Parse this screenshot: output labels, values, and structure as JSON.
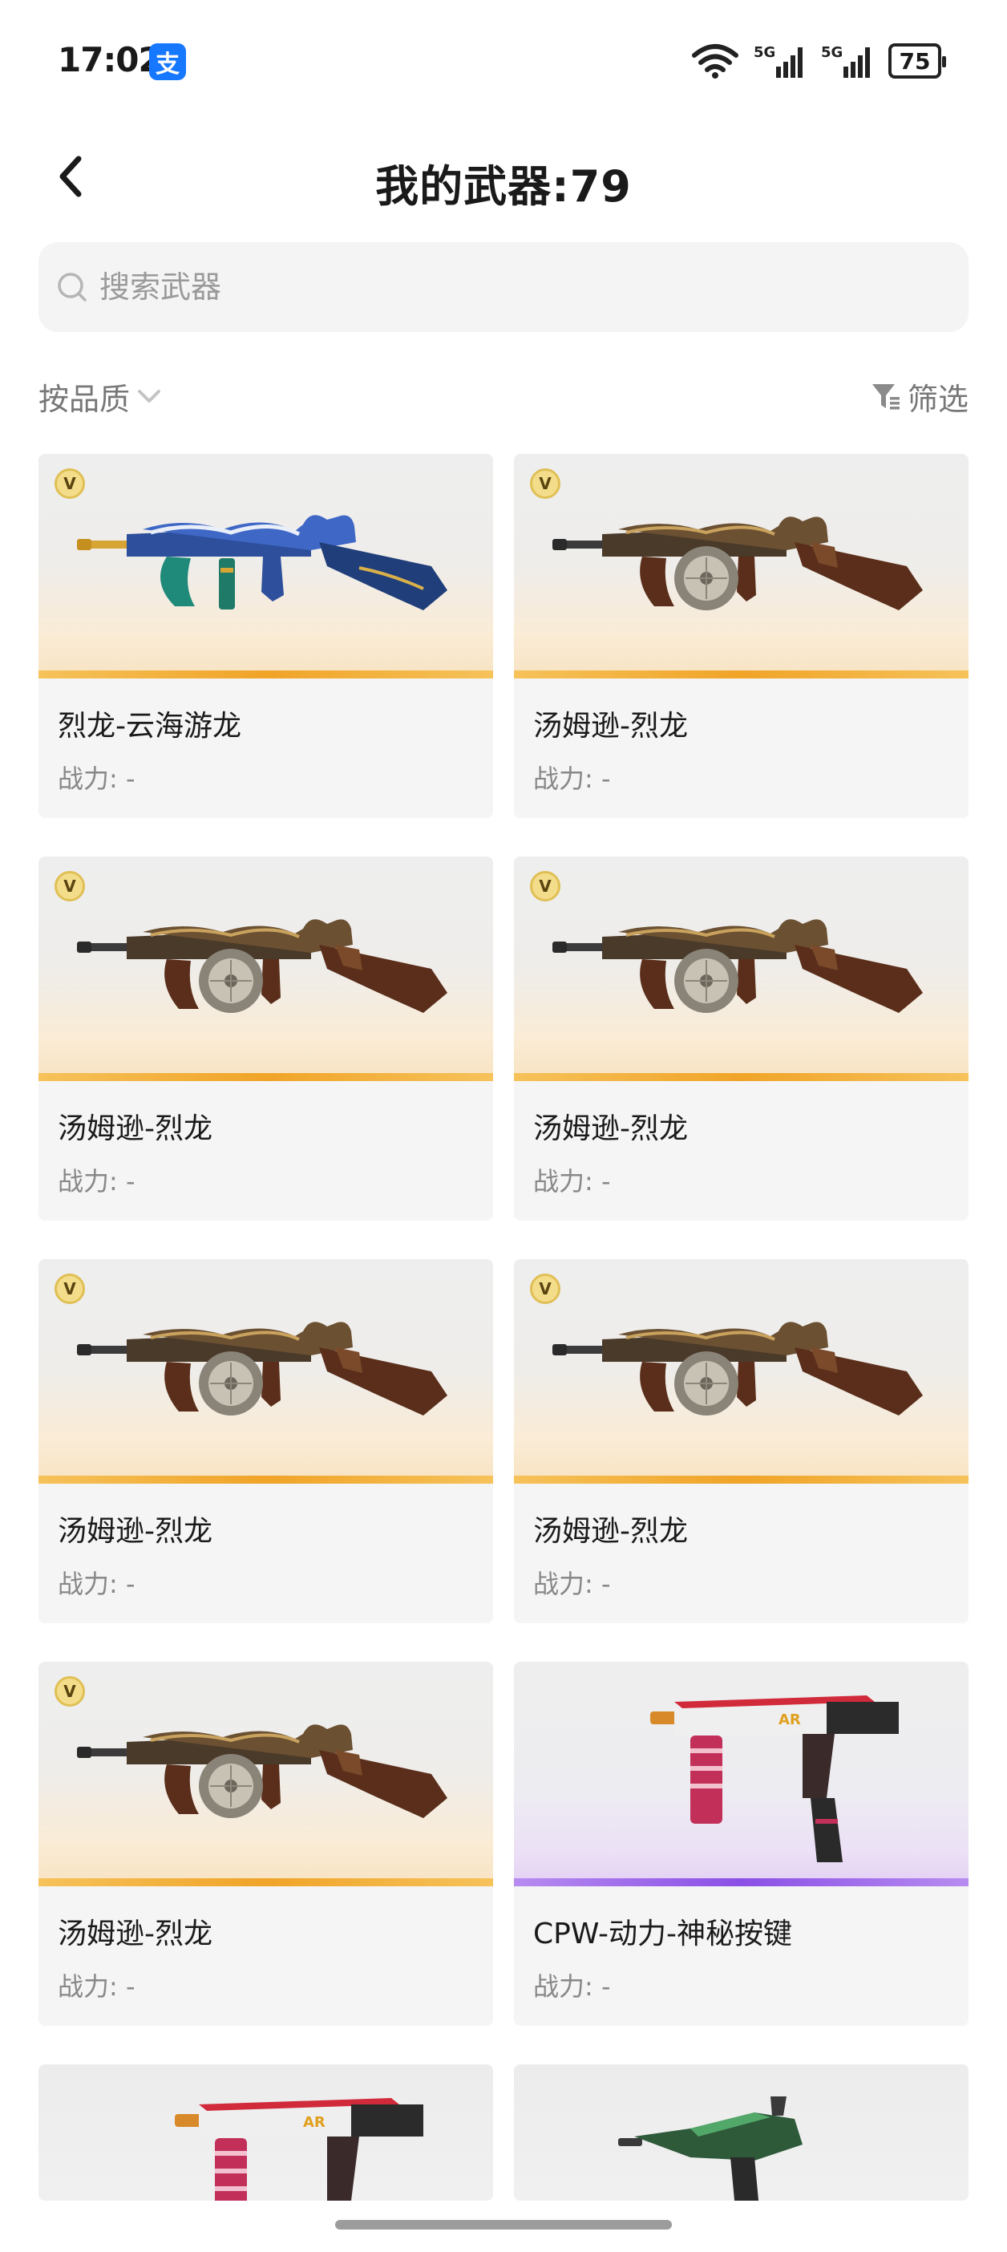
{
  "status_bar": {
    "time": "17:02",
    "app_badge": "支",
    "signal_1": "5G",
    "signal_2": "5G",
    "battery": "75"
  },
  "header": {
    "title": "我的武器:79"
  },
  "search": {
    "placeholder": "搜索武器"
  },
  "filters": {
    "sort_label": "按品质",
    "filter_label": "筛选"
  },
  "weapons": [
    {
      "name": "烈龙-云海游龙",
      "power": "战力: -",
      "rarity": "gold",
      "badge": "V",
      "art": "blue-dragon-smg"
    },
    {
      "name": "汤姆逊-烈龙",
      "power": "战力: -",
      "rarity": "gold",
      "badge": "V",
      "art": "dragon-smg"
    },
    {
      "name": "汤姆逊-烈龙",
      "power": "战力: -",
      "rarity": "gold",
      "badge": "V",
      "art": "dragon-smg"
    },
    {
      "name": "汤姆逊-烈龙",
      "power": "战力: -",
      "rarity": "gold",
      "badge": "V",
      "art": "dragon-smg"
    },
    {
      "name": "汤姆逊-烈龙",
      "power": "战力: -",
      "rarity": "gold",
      "badge": "V",
      "art": "dragon-smg"
    },
    {
      "name": "汤姆逊-烈龙",
      "power": "战力: -",
      "rarity": "gold",
      "badge": "V",
      "art": "dragon-smg"
    },
    {
      "name": "汤姆逊-烈龙",
      "power": "战力: -",
      "rarity": "gold",
      "badge": "V",
      "art": "dragon-smg"
    },
    {
      "name": "CPW-动力-神秘按键",
      "power": "战力: -",
      "rarity": "purple",
      "badge": "",
      "art": "cpw-smg"
    }
  ],
  "partial_weapons": [
    {
      "art": "cpw-smg"
    },
    {
      "art": "green-smg"
    }
  ],
  "colors": {
    "gold": "#f0a428",
    "purple": "#8a4fe6",
    "card_bg": "#f5f5f5",
    "search_bg": "#f4f4f4"
  }
}
